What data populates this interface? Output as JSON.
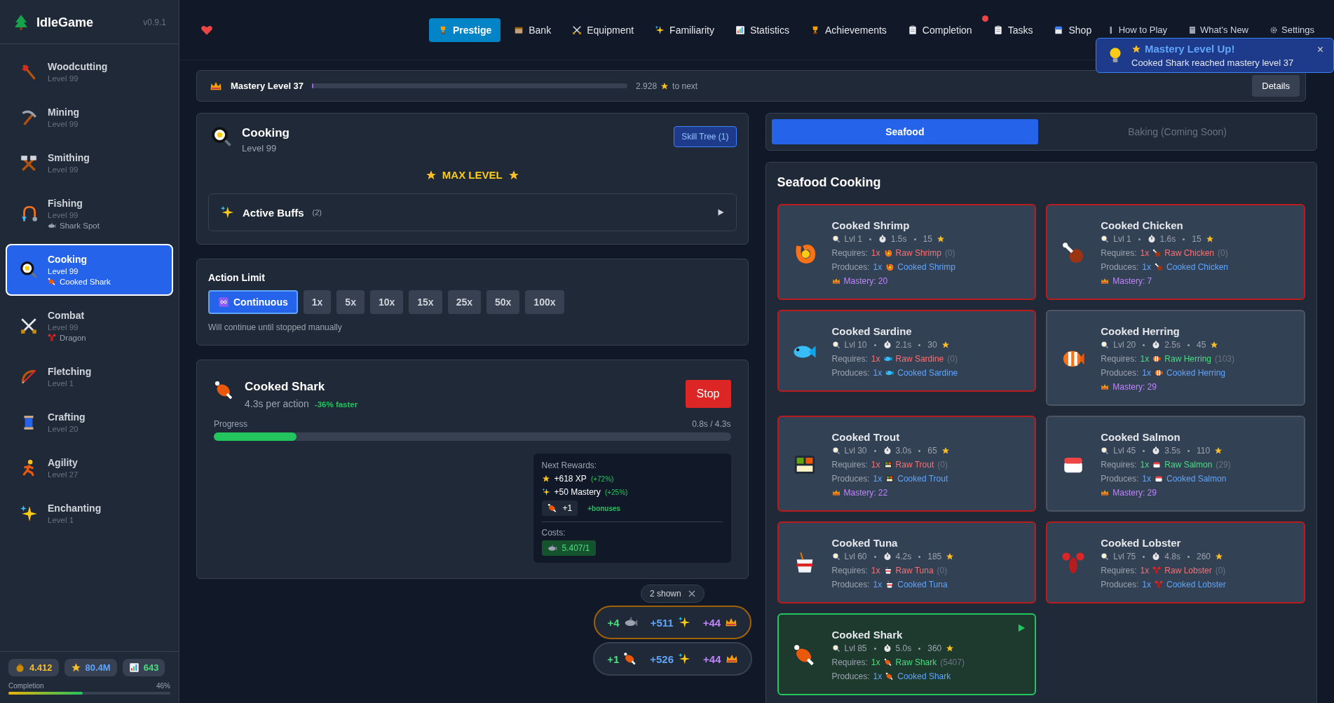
{
  "sidebar": {
    "logo": "IdleGame",
    "version": "v0.9.1",
    "skills": [
      {
        "name": "Woodcutting",
        "level": "Level 99",
        "selected": false
      },
      {
        "name": "Mining",
        "level": "Level 99",
        "selected": false
      },
      {
        "name": "Smithing",
        "level": "Level 99",
        "selected": false
      },
      {
        "name": "Fishing",
        "level": "Level 99",
        "activity": "Shark Spot",
        "selected": false
      },
      {
        "name": "Cooking",
        "level": "Level 99",
        "activity": "Cooked Shark",
        "selected": true
      },
      {
        "name": "Combat",
        "level": "Level 99",
        "activity": "Dragon",
        "selected": false
      },
      {
        "name": "Fletching",
        "level": "Level 1",
        "selected": false
      },
      {
        "name": "Crafting",
        "level": "Level 20",
        "selected": false
      },
      {
        "name": "Agility",
        "level": "Level 27",
        "selected": false
      },
      {
        "name": "Enchanting",
        "level": "Level 1",
        "selected": false
      }
    ],
    "stats": [
      {
        "kind": "gold",
        "value": "4.412"
      },
      {
        "kind": "xp",
        "value": "80.4M"
      },
      {
        "kind": "total",
        "value": "643"
      }
    ],
    "completion": {
      "label": "Completion",
      "percent": "46%",
      "level": 0.46
    }
  },
  "nav": {
    "items": [
      {
        "label": "Prestige",
        "selected": true,
        "notification": false
      },
      {
        "label": "Bank",
        "selected": false,
        "notification": false
      },
      {
        "label": "Equipment",
        "selected": false,
        "notification": false
      },
      {
        "label": "Familiarity",
        "selected": false,
        "notification": false
      },
      {
        "label": "Statistics",
        "selected": false,
        "notification": false
      },
      {
        "label": "Achievements",
        "selected": false,
        "notification": false
      },
      {
        "label": "Completion",
        "selected": false,
        "notification": true
      },
      {
        "label": "Tasks",
        "selected": false,
        "notification": false
      },
      {
        "label": "Shop",
        "selected": false,
        "notification": false
      }
    ],
    "help": [
      "How to Play",
      "What's New",
      "Settings"
    ]
  },
  "toast": {
    "title": "Mastery Level Up!",
    "message": "Cooked Shark reached mastery level 37",
    "close": "×"
  },
  "mastery": {
    "title": "Mastery Level 37",
    "level": 0.005,
    "remaining": "2.928",
    "suffix": "to next",
    "button": "Details"
  },
  "skill": {
    "name": "Cooking",
    "level": "Level 99",
    "tree_button": "Skill Tree (1)",
    "max_level": "MAX LEVEL",
    "buffs": {
      "label": "Active Buffs",
      "count": "(2)",
      "expanded": false
    }
  },
  "action_limit": {
    "title": "Action Limit",
    "options": [
      {
        "label": "Continuous",
        "selected": true
      },
      {
        "label": "1x",
        "selected": false
      },
      {
        "label": "5x",
        "selected": false
      },
      {
        "label": "10x",
        "selected": false
      },
      {
        "label": "15x",
        "selected": false
      },
      {
        "label": "25x",
        "selected": false
      },
      {
        "label": "50x",
        "selected": false
      },
      {
        "label": "100x",
        "selected": false
      }
    ],
    "note": "Will continue until stopped manually"
  },
  "current": {
    "name": "Cooked Shark",
    "time": "4.3s per action",
    "bonus": "-36% faster",
    "stop": "Stop",
    "progress_label": "Progress",
    "progress_time": "0.8s / 4.3s",
    "level": 0.16,
    "rewards_title": "Next Rewards:",
    "rewards": [
      {
        "kind": "xp",
        "text": "+618 XP",
        "bonus": "(+72%)"
      },
      {
        "kind": "mastery",
        "text": "+50 Mastery",
        "bonus": "(+25%)"
      }
    ],
    "item_reward": {
      "amount": "+1",
      "extra": "+bonuses"
    },
    "costs_title": "Costs:",
    "cost": "5.407/1"
  },
  "drops": {
    "badge": "2 shown",
    "rows": [
      {
        "highlighted": true,
        "item": "+4",
        "xp": "+511",
        "mastery": "+44"
      },
      {
        "highlighted": false,
        "item": "+1",
        "xp": "+526",
        "mastery": "+44"
      }
    ]
  },
  "categories": [
    {
      "label": "Seafood",
      "selected": true,
      "disabled": false
    },
    {
      "label": "Baking (Coming Soon)",
      "selected": false,
      "disabled": true
    }
  ],
  "recipes": {
    "title": "Seafood Cooking",
    "items": [
      {
        "name": "Cooked Shrimp",
        "level": "Lvl 1",
        "time": "1.5s",
        "xp": "15",
        "requires_label": "Requires:",
        "req_qty": "1x",
        "req_item": "Raw Shrimp",
        "req_count": "(0)",
        "available": false,
        "produces_label": "Produces:",
        "prod_qty": "1x",
        "prod_item": "Cooked Shrimp",
        "mastery": "Mastery: 20",
        "active": false
      },
      {
        "name": "Cooked Chicken",
        "level": "Lvl 1",
        "time": "1.6s",
        "xp": "15",
        "requires_label": "Requires:",
        "req_qty": "1x",
        "req_item": "Raw Chicken",
        "req_count": "(0)",
        "available": false,
        "produces_label": "Produces:",
        "prod_qty": "1x",
        "prod_item": "Cooked Chicken",
        "mastery": "Mastery: 7",
        "active": false
      },
      {
        "name": "Cooked Sardine",
        "level": "Lvl 10",
        "time": "2.1s",
        "xp": "30",
        "requires_label": "Requires:",
        "req_qty": "1x",
        "req_item": "Raw Sardine",
        "req_count": "(0)",
        "available": false,
        "produces_label": "Produces:",
        "prod_qty": "1x",
        "prod_item": "Cooked Sardine",
        "active": false
      },
      {
        "name": "Cooked Herring",
        "level": "Lvl 20",
        "time": "2.5s",
        "xp": "45",
        "requires_label": "Requires:",
        "req_qty": "1x",
        "req_item": "Raw Herring",
        "req_count": "(103)",
        "available": true,
        "produces_label": "Produces:",
        "prod_qty": "1x",
        "prod_item": "Cooked Herring",
        "mastery": "Mastery: 29",
        "active": false
      },
      {
        "name": "Cooked Trout",
        "level": "Lvl 30",
        "time": "3.0s",
        "xp": "65",
        "requires_label": "Requires:",
        "req_qty": "1x",
        "req_item": "Raw Trout",
        "req_count": "(0)",
        "available": false,
        "produces_label": "Produces:",
        "prod_qty": "1x",
        "prod_item": "Cooked Trout",
        "mastery": "Mastery: 22",
        "active": false
      },
      {
        "name": "Cooked Salmon",
        "level": "Lvl 45",
        "time": "3.5s",
        "xp": "110",
        "requires_label": "Requires:",
        "req_qty": "1x",
        "req_item": "Raw Salmon",
        "req_count": "(29)",
        "available": true,
        "produces_label": "Produces:",
        "prod_qty": "1x",
        "prod_item": "Cooked Salmon",
        "mastery": "Mastery: 29",
        "active": false
      },
      {
        "name": "Cooked Tuna",
        "level": "Lvl 60",
        "time": "4.2s",
        "xp": "185",
        "requires_label": "Requires:",
        "req_qty": "1x",
        "req_item": "Raw Tuna",
        "req_count": "(0)",
        "available": false,
        "produces_label": "Produces:",
        "prod_qty": "1x",
        "prod_item": "Cooked Tuna",
        "active": false
      },
      {
        "name": "Cooked Lobster",
        "level": "Lvl 75",
        "time": "4.8s",
        "xp": "260",
        "requires_label": "Requires:",
        "req_qty": "1x",
        "req_item": "Raw Lobster",
        "req_count": "(0)",
        "available": false,
        "produces_label": "Produces:",
        "prod_qty": "1x",
        "prod_item": "Cooked Lobster",
        "active": false
      },
      {
        "name": "Cooked Shark",
        "level": "Lvl 85",
        "time": "5.0s",
        "xp": "360",
        "requires_label": "Requires:",
        "req_qty": "1x",
        "req_item": "Raw Shark",
        "req_count": "(5407)",
        "available": true,
        "produces_label": "Produces:",
        "prod_qty": "1x",
        "prod_item": "Cooked Shark",
        "active": true
      }
    ]
  }
}
